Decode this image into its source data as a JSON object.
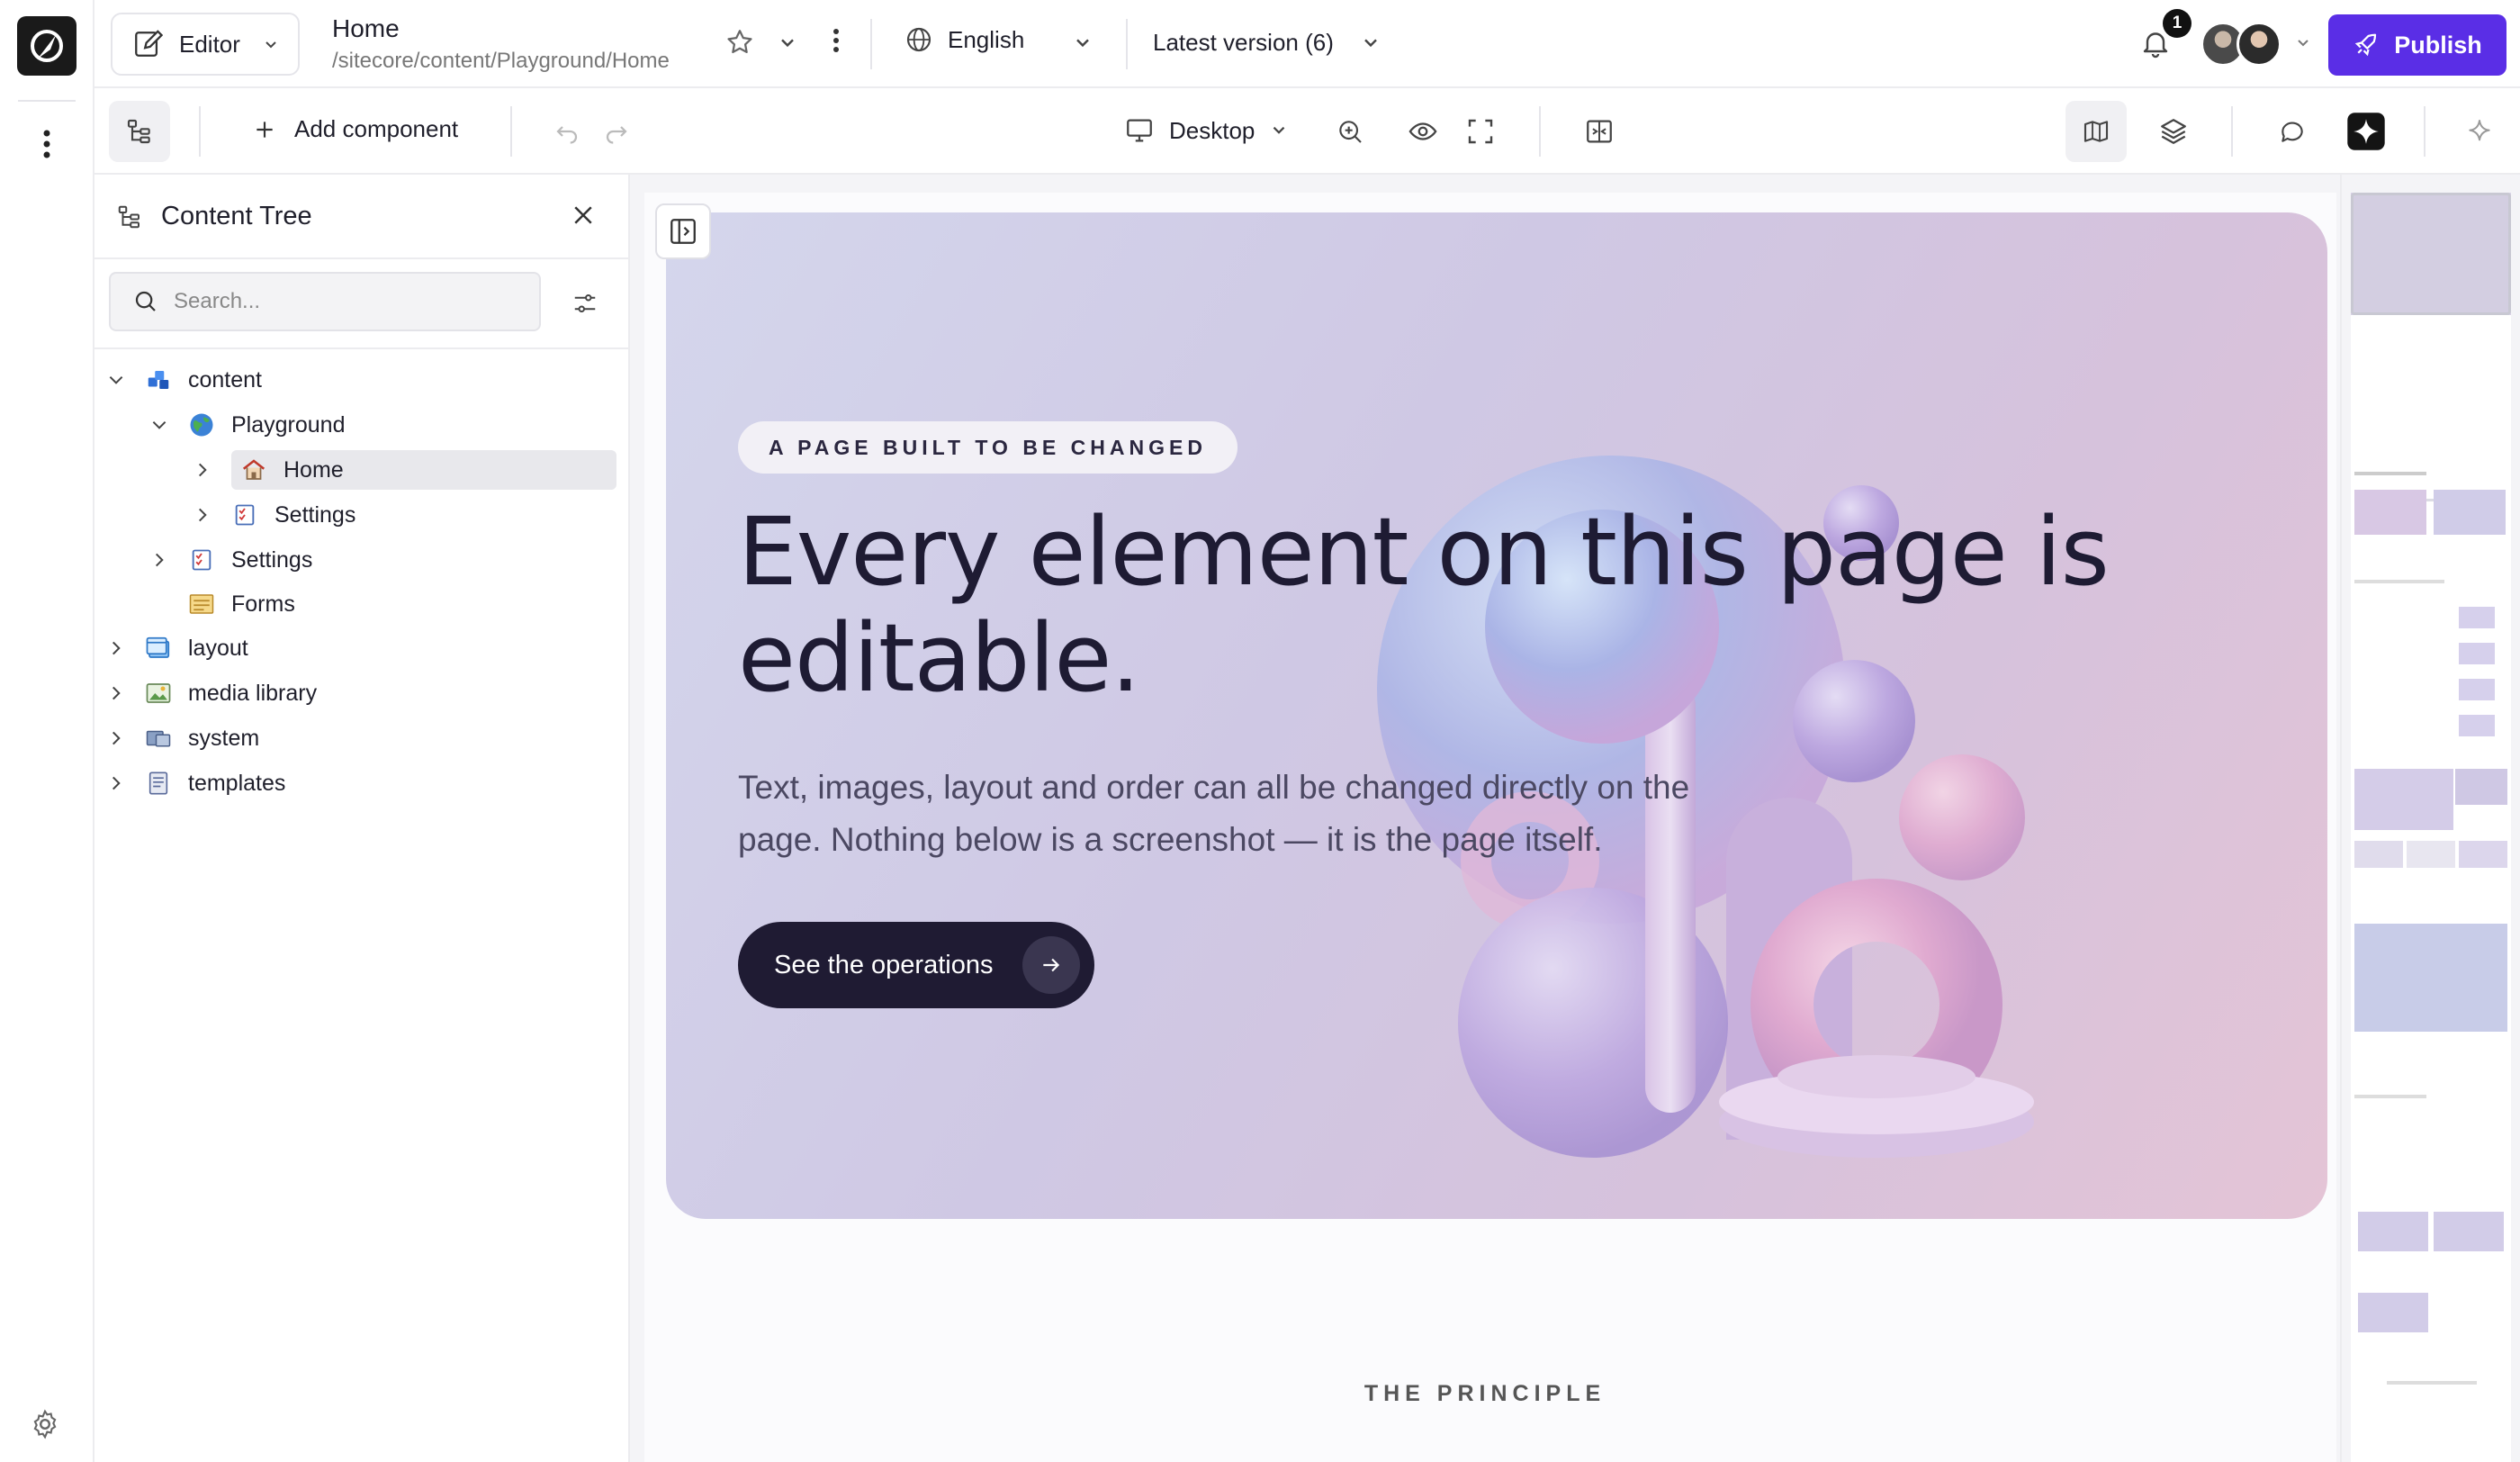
{
  "app": {
    "mode_label": "Editor",
    "page_title": "Home",
    "page_path": "/sitecore/content/Playground/Home",
    "language": "English",
    "version": "Latest version (6)",
    "notification_count": "1",
    "publish_label": "Publish",
    "accent_color": "#5a2ee6"
  },
  "toolbar": {
    "add_component_label": "Add component",
    "device_label": "Desktop"
  },
  "content_tree": {
    "title": "Content Tree",
    "search_placeholder": "Search...",
    "nodes": [
      {
        "label": "content",
        "icon": "content-stack-icon",
        "expanded": true
      },
      {
        "label": "Playground",
        "icon": "globe-icon",
        "expanded": true
      },
      {
        "label": "Home",
        "icon": "home-icon",
        "selected": true
      },
      {
        "label": "Settings",
        "icon": "settings-doc-icon"
      },
      {
        "label": "Settings",
        "icon": "settings-doc-icon"
      },
      {
        "label": "Forms",
        "icon": "forms-icon"
      },
      {
        "label": "layout",
        "icon": "layout-icon"
      },
      {
        "label": "media library",
        "icon": "media-icon"
      },
      {
        "label": "system",
        "icon": "system-icon"
      },
      {
        "label": "templates",
        "icon": "templates-icon"
      }
    ]
  },
  "hero": {
    "eyebrow": "A PAGE BUILT TO BE CHANGED",
    "headline": "Every element on this page is editable.",
    "subtext": "Text, images, layout and order can all be changed directly on the page. Nothing below is a screenshot — it is the page itself.",
    "cta_label": "See the operations"
  },
  "section": {
    "principle_label": "THE PRINCIPLE"
  }
}
